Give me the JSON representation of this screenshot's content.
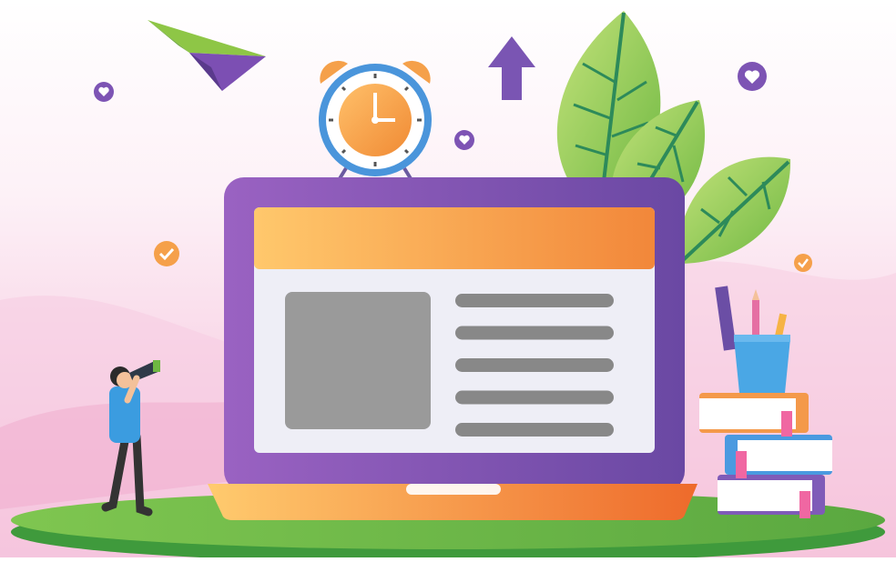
{
  "scene": {
    "title": "",
    "colors": {
      "purple": "#8a55b8",
      "purple_dark": "#6b3fa0",
      "orange": "#f6a04a",
      "orange_light": "#ffc76b",
      "orange_dark": "#ee6d2c",
      "green": "#67b845",
      "green_dark": "#3f8f3a",
      "leaf": "#9bd05a",
      "pink_bg": "#f5c9e0",
      "screen_bg": "#eeeef5",
      "placeholder_gray": "#999999",
      "line_gray": "#888888",
      "blue": "#49a6e5"
    },
    "icons": [
      "paper-plane-icon",
      "alarm-clock-icon",
      "up-arrow-icon",
      "leaves-icon",
      "heart-badge-icon",
      "check-badge-icon",
      "laptop-icon",
      "person-with-telescope-icon",
      "pencil-cup-icon",
      "books-stack-icon"
    ],
    "laptop_content_lines": 5
  }
}
